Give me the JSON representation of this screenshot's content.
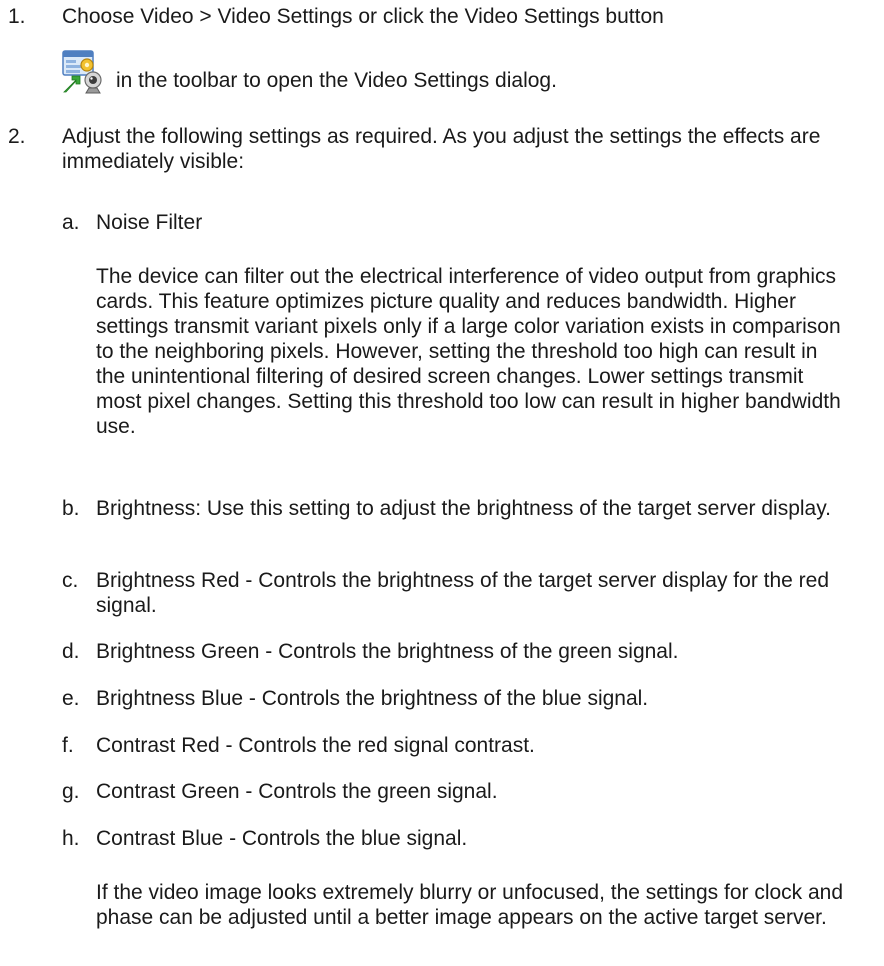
{
  "steps": [
    {
      "number": "1.",
      "text_line1": "Choose Video > Video Settings or click the Video Settings button",
      "icon": "video-settings-icon",
      "text_line2": "in the toolbar to open the Video Settings dialog."
    },
    {
      "number": "2.",
      "text": "Adjust the following settings as required. As you adjust the settings the effects are immediately visible:",
      "substeps": [
        {
          "letter": "a.",
          "text": "Noise Filter",
          "detail": "The   device can filter out the electrical interference of video output from graphics cards. This feature optimizes picture quality and reduces bandwidth. Higher settings transmit variant pixels only if a large color variation exists in comparison to the neighboring pixels. However, setting the threshold too high can result in the unintentional filtering of desired screen changes. Lower settings transmit most pixel changes. Setting this threshold too low can result in higher bandwidth use."
        },
        {
          "letter": "b.",
          "text": "Brightness: Use this setting to adjust the brightness of the target server display."
        },
        {
          "letter": "c.",
          "text": "Brightness Red - Controls the brightness of the target server display for the red signal."
        },
        {
          "letter": "d.",
          "text": "Brightness Green - Controls the brightness of the green signal."
        },
        {
          "letter": "e.",
          "text": "Brightness Blue - Controls the brightness of the blue signal."
        },
        {
          "letter": "f.",
          "text": "Contrast Red - Controls the red signal contrast."
        },
        {
          "letter": "g.",
          "text": "Contrast Green - Controls the green signal."
        },
        {
          "letter": "h.",
          "text": "Contrast Blue - Controls the blue signal."
        }
      ],
      "closing": "If the video image looks extremely blurry or unfocused, the settings for clock and phase can be adjusted until a better image appears on the active target server."
    }
  ]
}
